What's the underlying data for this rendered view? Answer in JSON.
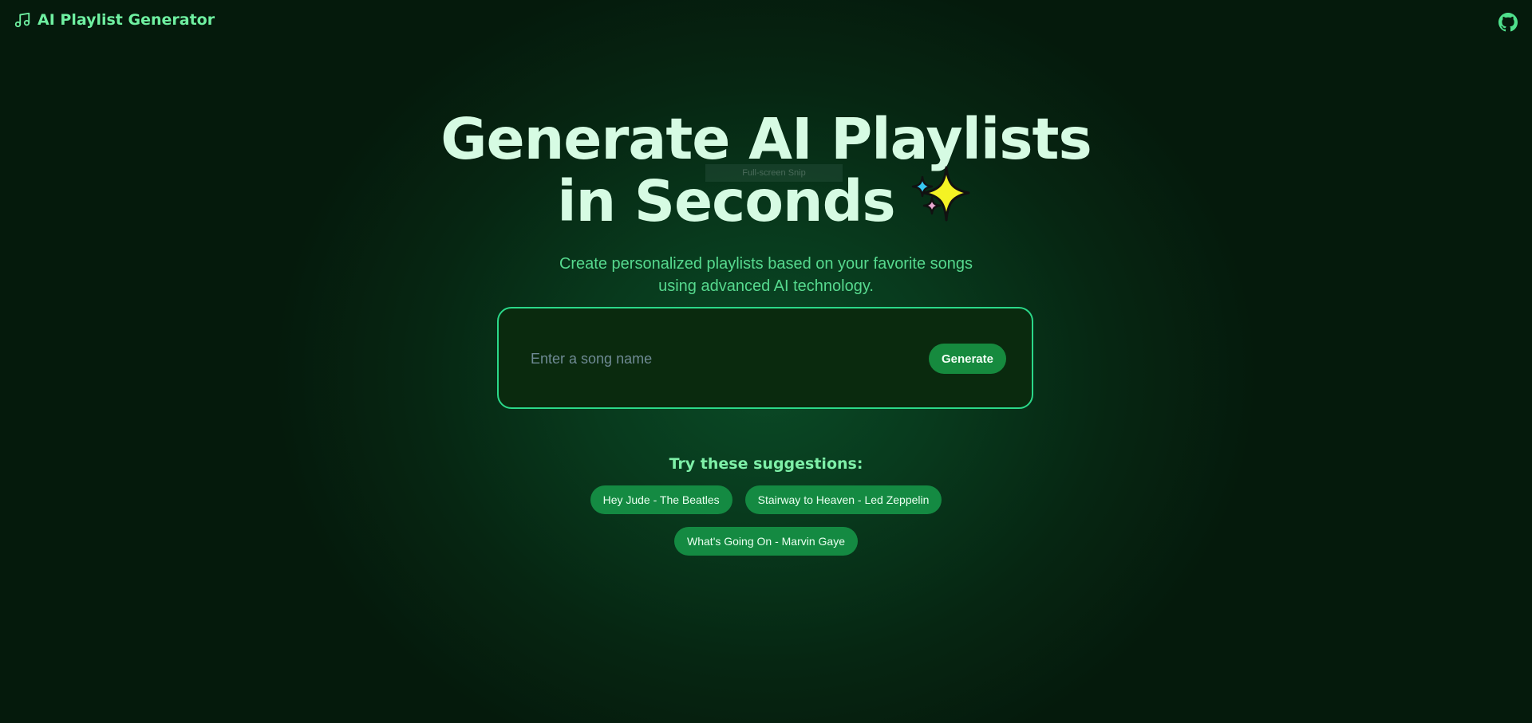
{
  "navbar": {
    "title": "AI Playlist Generator",
    "logo_icon": "music-note-icon",
    "github_icon": "github-icon"
  },
  "hero": {
    "headline_line1": "Generate AI Playlists",
    "headline_line2": "in Seconds",
    "sparkle_icon": "sparkles-icon",
    "subtitle": "Create personalized playlists based on your favorite songs using advanced AI technology."
  },
  "overlay": {
    "snip_label": "Full-screen Snip"
  },
  "search": {
    "placeholder": "Enter a song name",
    "value": "",
    "button_label": "Generate"
  },
  "suggestions": {
    "title": "Try these suggestions:",
    "items": [
      {
        "label": "Hey Jude - The Beatles"
      },
      {
        "label": "Stairway to Heaven - Led Zeppelin"
      },
      {
        "label": "What's Going On - Marvin Gaye"
      }
    ]
  },
  "colors": {
    "accent": "#6ff0a1",
    "button": "#168a3e",
    "border": "#2bd889",
    "background": "#062612"
  }
}
